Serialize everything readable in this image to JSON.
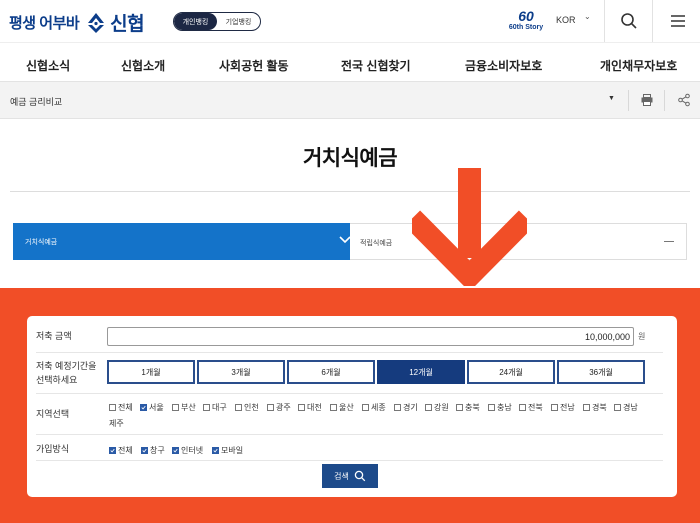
{
  "header": {
    "slogan": "평생 어부바",
    "brand_name": "신협",
    "segment": {
      "personal": "개인뱅킹",
      "business": "기업뱅킹"
    },
    "anniversary": {
      "number": "60",
      "text": "60th Story"
    },
    "language": "KOR",
    "brand_color": "#0c3d8a"
  },
  "nav": {
    "items": [
      "신협소식",
      "신협소개",
      "사회공헌 활동",
      "전국 신협찾기",
      "금융소비자보호",
      "개인채무자보호"
    ]
  },
  "breadcrumb": {
    "current": "예금 금리비교"
  },
  "page": {
    "title": "거치식예금"
  },
  "tabs": {
    "active": "거치식예금",
    "other": "적립식예금",
    "active_color": "#1473c9"
  },
  "overlay": {
    "arrow_color": "#f14e27",
    "background_color": "#f14e27"
  },
  "form": {
    "amount_label": "저축 금액",
    "amount_value": "10,000,000",
    "amount_unit": "원",
    "period_label_line1": "저축 예정기간을",
    "period_label_line2": "선택하세요",
    "periods": [
      "1개월",
      "3개월",
      "6개월",
      "12개월",
      "24개월",
      "36개월"
    ],
    "period_selected": "12개월",
    "region_label": "지역선택",
    "regions": [
      "전체",
      "서울",
      "부산",
      "대구",
      "인천",
      "광주",
      "대전",
      "울산",
      "세종",
      "경기",
      "강원",
      "충북",
      "충남",
      "전북",
      "전남",
      "경북",
      "경남",
      "제주"
    ],
    "regions_checked": [
      "서울"
    ],
    "join_label": "가입방식",
    "join_methods": [
      "전체",
      "창구",
      "인터넷",
      "모바일"
    ],
    "join_checked": [
      "전체",
      "창구",
      "인터넷",
      "모바일"
    ],
    "search_label": "검색"
  }
}
